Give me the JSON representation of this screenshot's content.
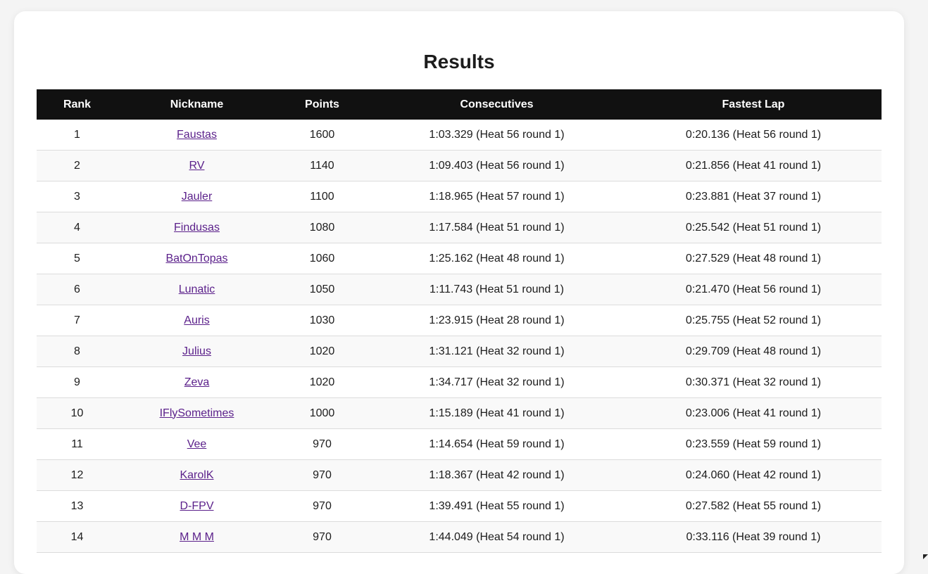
{
  "page": {
    "title": "Results"
  },
  "table": {
    "headers": [
      "Rank",
      "Nickname",
      "Points",
      "Consecutives",
      "Fastest Lap"
    ],
    "rows": [
      {
        "rank": "1",
        "nickname": "Faustas",
        "points": "1600",
        "consecutives": "1:03.329 (Heat 56 round 1)",
        "fastest_lap": "0:20.136 (Heat 56 round 1)"
      },
      {
        "rank": "2",
        "nickname": "RV",
        "points": "1140",
        "consecutives": "1:09.403 (Heat 56 round 1)",
        "fastest_lap": "0:21.856 (Heat 41 round 1)"
      },
      {
        "rank": "3",
        "nickname": "Jauler",
        "points": "1100",
        "consecutives": "1:18.965 (Heat 57 round 1)",
        "fastest_lap": "0:23.881 (Heat 37 round 1)"
      },
      {
        "rank": "4",
        "nickname": "Findusas",
        "points": "1080",
        "consecutives": "1:17.584 (Heat 51 round 1)",
        "fastest_lap": "0:25.542 (Heat 51 round 1)"
      },
      {
        "rank": "5",
        "nickname": "BatOnTopas",
        "points": "1060",
        "consecutives": "1:25.162 (Heat 48 round 1)",
        "fastest_lap": "0:27.529 (Heat 48 round 1)"
      },
      {
        "rank": "6",
        "nickname": "Lunatic",
        "points": "1050",
        "consecutives": "1:11.743 (Heat 51 round 1)",
        "fastest_lap": "0:21.470 (Heat 56 round 1)"
      },
      {
        "rank": "7",
        "nickname": "Auris",
        "points": "1030",
        "consecutives": "1:23.915 (Heat 28 round 1)",
        "fastest_lap": "0:25.755 (Heat 52 round 1)"
      },
      {
        "rank": "8",
        "nickname": "Julius",
        "points": "1020",
        "consecutives": "1:31.121 (Heat 32 round 1)",
        "fastest_lap": "0:29.709 (Heat 48 round 1)"
      },
      {
        "rank": "9",
        "nickname": "Zeva",
        "points": "1020",
        "consecutives": "1:34.717 (Heat 32 round 1)",
        "fastest_lap": "0:30.371 (Heat 32 round 1)"
      },
      {
        "rank": "10",
        "nickname": "IFlySometimes",
        "points": "1000",
        "consecutives": "1:15.189 (Heat 41 round 1)",
        "fastest_lap": "0:23.006 (Heat 41 round 1)"
      },
      {
        "rank": "11",
        "nickname": "Vee",
        "points": "970",
        "consecutives": "1:14.654 (Heat 59 round 1)",
        "fastest_lap": "0:23.559 (Heat 59 round 1)"
      },
      {
        "rank": "12",
        "nickname": "KarolK",
        "points": "970",
        "consecutives": "1:18.367 (Heat 42 round 1)",
        "fastest_lap": "0:24.060 (Heat 42 round 1)"
      },
      {
        "rank": "13",
        "nickname": "D-FPV",
        "points": "970",
        "consecutives": "1:39.491 (Heat 55 round 1)",
        "fastest_lap": "0:27.582 (Heat 55 round 1)"
      },
      {
        "rank": "14",
        "nickname": "M M M",
        "points": "970",
        "consecutives": "1:44.049 (Heat 54 round 1)",
        "fastest_lap": "0:33.116 (Heat 39 round 1)"
      }
    ]
  },
  "colors": {
    "header_bg": "#111111",
    "link": "#5a1f8a",
    "alt_row": "#f9f9f9"
  }
}
